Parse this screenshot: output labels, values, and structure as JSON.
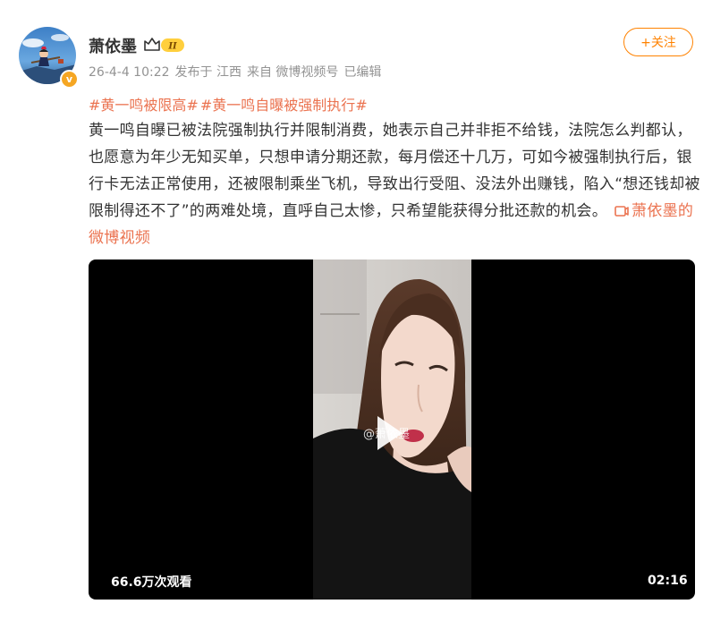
{
  "post": {
    "author": {
      "name": "萧依墨",
      "avatar_badge": "v",
      "vip_level": "II"
    },
    "meta": {
      "time": "26-4-4 10:22",
      "location": "发布于 江西",
      "source": "来自 微博视频号",
      "edited": "已编辑"
    },
    "follow_label": "+关注",
    "topics": [
      "#黄一鸣被限高#",
      "#黄一鸣自曝被强制执行#"
    ],
    "body": "黄一鸣自曝已被法院强制执行并限制消费，她表示自己并非拒不给钱，法院怎么判都认，也愿意为年少无知买单，只想申请分期还款，每月偿还十几万，可如今被强制执行后，银行卡无法正常使用，还被限制乘坐飞机，导致出行受阻、没法外出赚钱，陷入“想还钱却被限制得还不了”的两难处境，直呼自己太惨，只希望能获得分批还款的机会。",
    "video_link": "萧依墨的微博视频",
    "video": {
      "watermark": "@萧依墨",
      "views": "66.6万次观看",
      "duration": "02:16"
    }
  },
  "colors": {
    "accent_orange": "#ff8200",
    "link": "#eb7350",
    "meta_gray": "#939393",
    "text": "#333333",
    "video_bg": "#000000"
  },
  "icons": [
    "verified-v-icon",
    "vip-crown-icon",
    "video-link-icon",
    "play-icon"
  ]
}
